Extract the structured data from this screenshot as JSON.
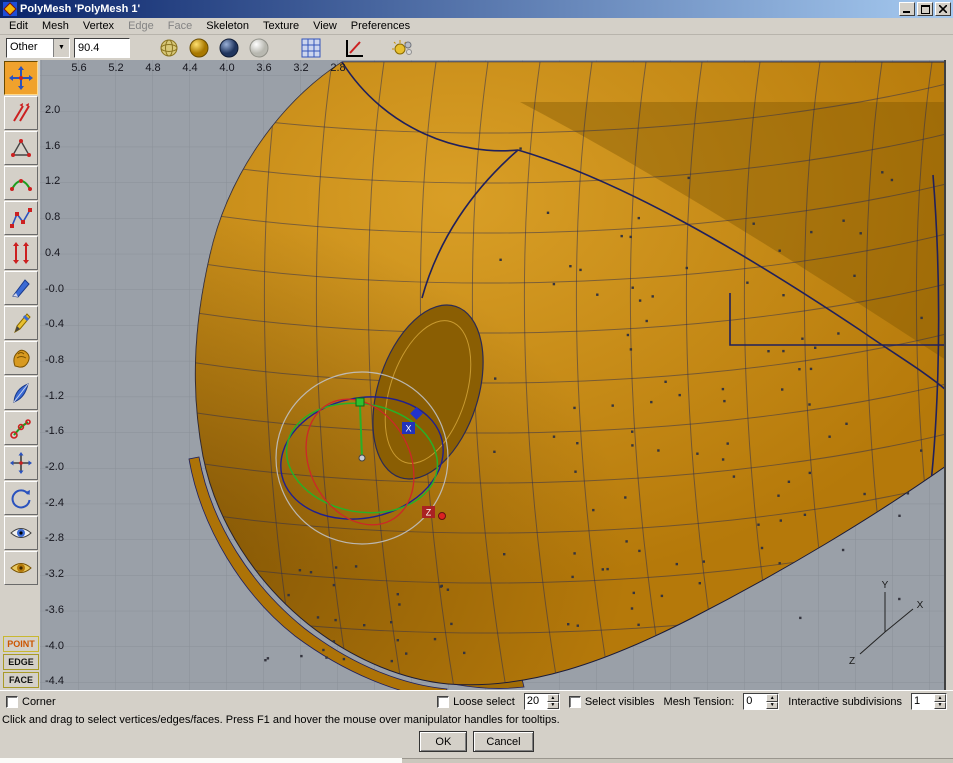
{
  "window": {
    "title": "PolyMesh 'PolyMesh 1'"
  },
  "menu": {
    "items": [
      {
        "label": "Edit",
        "enabled": true
      },
      {
        "label": "Mesh",
        "enabled": true
      },
      {
        "label": "Vertex",
        "enabled": true
      },
      {
        "label": "Edge",
        "enabled": false
      },
      {
        "label": "Face",
        "enabled": false
      },
      {
        "label": "Skeleton",
        "enabled": true
      },
      {
        "label": "Texture",
        "enabled": true
      },
      {
        "label": "View",
        "enabled": true
      },
      {
        "label": "Preferences",
        "enabled": true
      }
    ]
  },
  "toolbar": {
    "mode_value": "Other",
    "angle_value": "90.4",
    "icons": [
      "wire-sphere-icon",
      "smooth-shaded-sphere-icon",
      "dark-shaded-sphere-icon",
      "transparent-sphere-icon",
      "grid-icon",
      "corner-view-icon",
      "render-preview-icon"
    ]
  },
  "left_toolbar": {
    "tools": [
      "move-tool",
      "skew-tool",
      "taper-tool",
      "bend-tool",
      "spline-tool",
      "scale-tool",
      "knife-tool",
      "pencil-tool",
      "sculpt-tool",
      "feather-tool",
      "skeleton-tool",
      "translate-axes-tool",
      "rotate-view-tool",
      "show-vertices-eye-tool",
      "hide-vertices-eye-tool"
    ],
    "mode_buttons": [
      {
        "label": "POINT",
        "active": true
      },
      {
        "label": "EDGE",
        "active": false
      },
      {
        "label": "FACE",
        "active": false
      }
    ]
  },
  "viewport": {
    "ruler_top": [
      "5.6",
      "5.2",
      "4.8",
      "4.4",
      "4.0",
      "3.6",
      "3.2",
      "2.8"
    ],
    "ruler_left": [
      "2.0",
      "1.6",
      "1.2",
      "0.8",
      "0.4",
      "-0.0",
      "-0.4",
      "-0.8",
      "-1.2",
      "-1.6",
      "-2.0",
      "-2.4",
      "-2.8",
      "-3.2",
      "-3.6",
      "-4.0",
      "-4.4"
    ],
    "manipulator": {
      "x_label": "X",
      "z_label": "Z"
    },
    "axis": {
      "x": "X",
      "y": "Y",
      "z": "Z"
    }
  },
  "bottom_bar": {
    "corner_label": "Corner",
    "loose_select_label": "Loose select",
    "loose_select_value": "20",
    "select_visibles_label": "Select visibles",
    "mesh_tension_label": "Mesh Tension:",
    "mesh_tension_value": "0",
    "subdivisions_label": "Interactive subdivisions",
    "subdivisions_value": "1"
  },
  "status": "Click and drag to select vertices/edges/faces. Press F1 and hover the mouse over manipulator handles for tooltips.",
  "dialog_buttons": {
    "ok": "OK",
    "cancel": "Cancel"
  },
  "colors": {
    "titlebar_start": "#0a246a",
    "titlebar_end": "#a6caf0",
    "chrome": "#d4d0c8",
    "viewport_bg": "#9aa0a8",
    "grid_line": "#8a9098",
    "mesh_gold": "#b5790a",
    "mesh_highlight": "#d89a20",
    "mesh_shadow": "#7a5200",
    "wire_navy": "#20205c",
    "manip_green": "#28b028",
    "manip_red": "#cc2828",
    "manip_blue": "#2233cc"
  }
}
